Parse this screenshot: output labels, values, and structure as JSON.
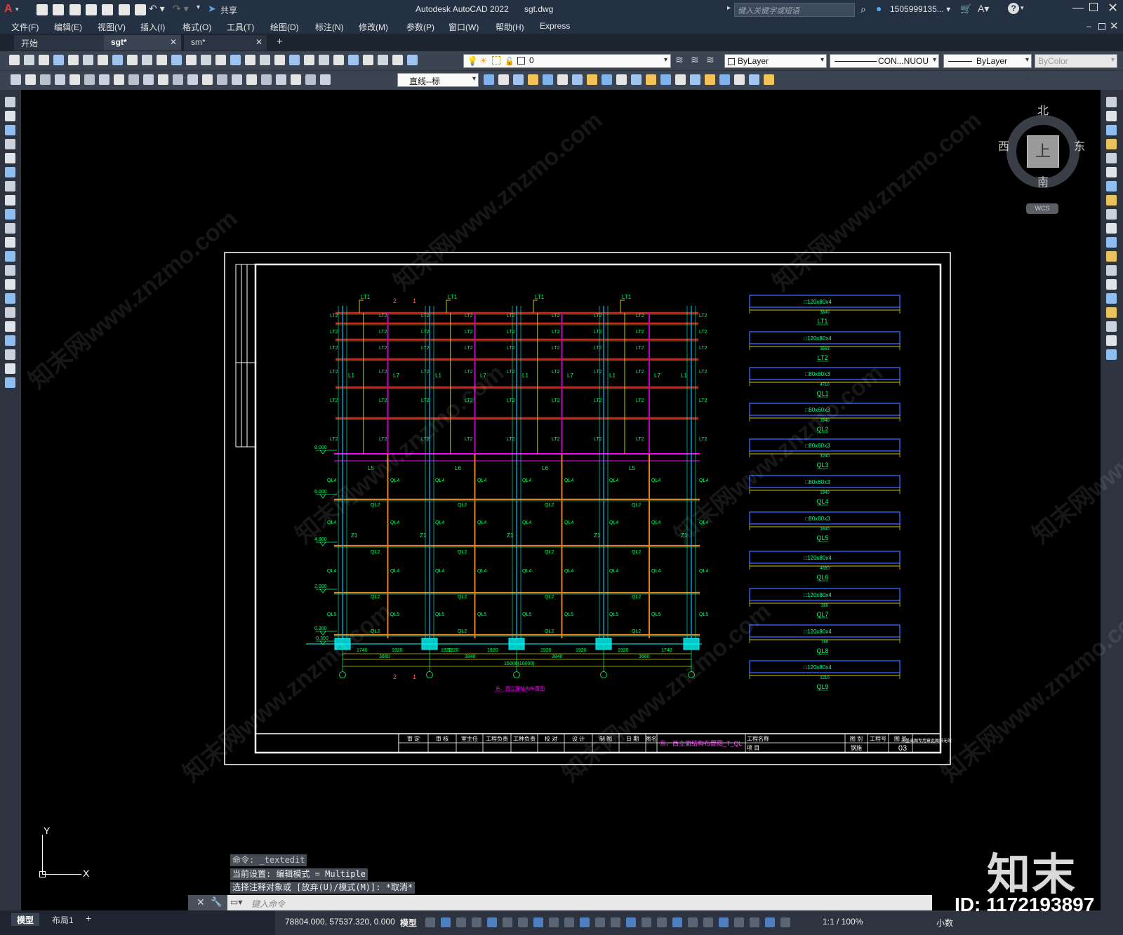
{
  "app": {
    "title": "Autodesk AutoCAD 2022",
    "file": "sgt.dwg",
    "logo": "A"
  },
  "titlebar": {
    "share_label": "共享",
    "search_placeholder": "键入关键字或短语",
    "user": "1505999135... ▾"
  },
  "menu": [
    "文件(F)",
    "编辑(E)",
    "视图(V)",
    "插入(I)",
    "格式(O)",
    "工具(T)",
    "绘图(D)",
    "标注(N)",
    "修改(M)",
    "参数(P)",
    "窗口(W)",
    "帮助(H)",
    "Express"
  ],
  "tabs": [
    {
      "label": "开始"
    },
    {
      "label": "sgt*"
    },
    {
      "label": "sm*"
    }
  ],
  "toolbar": {
    "layer_value": "0",
    "color_value": "ByLayer",
    "linetype_value": "CON...NUOU",
    "lineweight_value": "ByLayer",
    "plotstyle_value": "ByColor",
    "dimstyle_value": "直线--标"
  },
  "viewcube": {
    "north": "北",
    "south": "南",
    "east": "东",
    "west": "西",
    "top": "上",
    "wcs": "WCS"
  },
  "ucs": {
    "x": "X",
    "y": "Y"
  },
  "command": {
    "history": [
      "命令: _textedit",
      "当前设置: 编辑模式 = Multiple",
      "选择注释对象或 [放弃(U)/模式(M)]: *取消*"
    ],
    "placeholder": "键入命令"
  },
  "status": {
    "coords": "78804.000, 57537.320, 0.000",
    "model": "模型",
    "scale": "1:1 / 100%",
    "units": "小数",
    "layout_tabs": [
      "模型",
      "布局1"
    ]
  },
  "watermark": {
    "brand": "知末",
    "id": "ID: 1172193897",
    "url": "知末网www.znzmo.com"
  },
  "drawing": {
    "top_labels": [
      "LT1",
      "LT1",
      "LT1",
      "LT1"
    ],
    "axis_labels": [
      "2",
      "1"
    ],
    "elev_labels": [
      "8.000",
      "6.000",
      "4.800",
      "2.000",
      "0.300",
      "-0.300"
    ],
    "dims_bottom": [
      "1740",
      "1920",
      "1920",
      "1920",
      "1920",
      "1920",
      "1920",
      "1920",
      "1740"
    ],
    "dims_bottom2": [
      "3660",
      "3840",
      "3840",
      "3660"
    ],
    "dim_total": "15000(10000)",
    "caption": "东、西立面结构布置图",
    "sections": [
      {
        "spec": "□120x80x4",
        "len": "3840",
        "name": "LT1"
      },
      {
        "spec": "□120x80x4",
        "len": "3563",
        "name": "LT2"
      },
      {
        "spec": "□80x60x3",
        "len": "4710",
        "name": "QL1"
      },
      {
        "spec": "□80x60x3",
        "len": "3840",
        "name": "QL2"
      },
      {
        "spec": "□80x60x3",
        "len": "3240",
        "name": "QL3"
      },
      {
        "spec": "□80x60x3",
        "len": "1940",
        "name": "QL4"
      },
      {
        "spec": "□80x60x3",
        "len": "1640",
        "name": "QL5"
      },
      {
        "spec": "□120x80x4",
        "len": "4660",
        "name": "QL6"
      },
      {
        "spec": "□120x80x4",
        "len": "369",
        "name": "QL7"
      },
      {
        "spec": "□120x80x4",
        "len": "789",
        "name": "QL8"
      },
      {
        "spec": "□120x80x4",
        "len": "1210",
        "name": "QL9"
      }
    ],
    "titleblock": {
      "cells": [
        "审 定",
        "审 核",
        "室主任",
        "工程负责",
        "工种负责",
        "校 对",
        "设 计",
        "制 图",
        "日 期",
        "图名"
      ],
      "drawing_name": "东、西立面结构布置图_T_QL",
      "project_label": "工程名称",
      "item_label": "项 目",
      "sheet_labels": [
        "图 别",
        "工程号",
        "图 号"
      ],
      "sheet_type": "钢施",
      "sheet_no": "03",
      "note": "未盖出图专用章此图纸无效"
    }
  }
}
